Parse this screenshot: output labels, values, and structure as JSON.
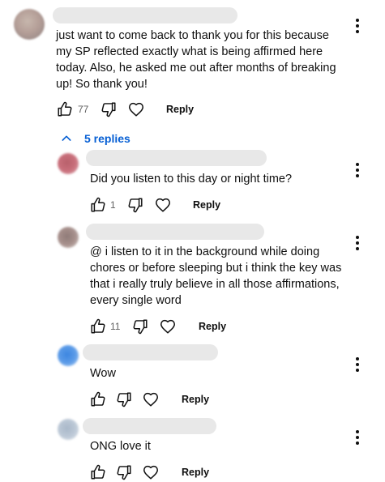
{
  "colors": {
    "link_blue": "#065fd4",
    "placeholder_gray": "#e8e8e8",
    "text_primary": "#0f0f0f",
    "text_secondary": "#606060"
  },
  "icons": {
    "like": "thumb-up-outline",
    "dislike": "thumb-down-outline",
    "heart": "heart-outline",
    "menu": "vertical-ellipsis",
    "expand": "chevron-up"
  },
  "comment": {
    "lines": [
      "just want to come back to thank you for this because",
      "my SP reflected exactly what is being affirmed here",
      "today. Also, he asked me out after months of breaking",
      "up! So thank you!"
    ],
    "likes": "77",
    "reply_label": "Reply",
    "replies_toggle": "5 replies"
  },
  "replies": [
    {
      "lines": [
        "Did you listen to this day or night time?"
      ],
      "likes": "1",
      "reply_label": "Reply"
    },
    {
      "lines": [
        "@ i listen to it in the background while doing",
        "chores or before sleeping but i think the key was",
        "that i really truly believe in all those affirmations,",
        "every single word"
      ],
      "likes": "11",
      "reply_label": "Reply"
    },
    {
      "lines": [
        "Wow"
      ],
      "likes": "",
      "reply_label": "Reply"
    },
    {
      "lines": [
        "ONG love it"
      ],
      "likes": "",
      "reply_label": "Reply"
    }
  ]
}
